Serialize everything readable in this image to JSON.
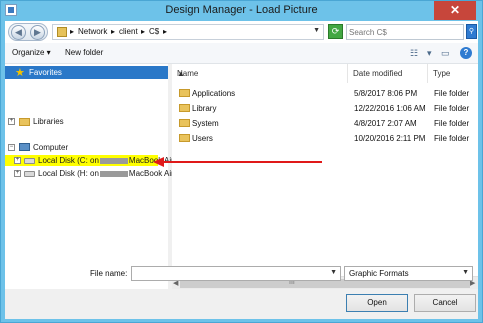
{
  "window": {
    "title": "Design Manager - Load Picture",
    "close_glyph": "✕"
  },
  "address": {
    "crumbs": [
      "Network",
      "client",
      "C$"
    ],
    "separator": "▸",
    "search_placeholder": "Search C$"
  },
  "toolbar": {
    "organize_label": "Organize ▾",
    "new_folder_label": "New folder"
  },
  "nav": {
    "favorites": "Favorites",
    "libraries": "Libraries",
    "computer": "Computer",
    "drive_c_prefix": "Local Disk (C: on",
    "drive_c_suffix": "MacBook Air)",
    "drive_h_prefix": "Local Disk (H: on",
    "drive_h_suffix": "MacBook Air)"
  },
  "filelist": {
    "columns": [
      "Name",
      "Date modified",
      "Type"
    ],
    "rows": [
      {
        "name": "Applications",
        "date": "5/8/2017 8:06 PM",
        "type": "File folder"
      },
      {
        "name": "Library",
        "date": "12/22/2016 1:06 AM",
        "type": "File folder"
      },
      {
        "name": "System",
        "date": "4/8/2017 2:07 AM",
        "type": "File folder"
      },
      {
        "name": "Users",
        "date": "10/20/2016 2:11 PM",
        "type": "File folder"
      }
    ],
    "scroll_grip": "III"
  },
  "bottom": {
    "file_name_label": "File name:",
    "file_name_value": "",
    "filter_value": "Graphic Formats",
    "open_label": "Open",
    "cancel_label": "Cancel"
  },
  "colors": {
    "annotation_arrow": "#e01919",
    "annotation_highlight": "#ffff00",
    "selection": "#2a78c8"
  }
}
